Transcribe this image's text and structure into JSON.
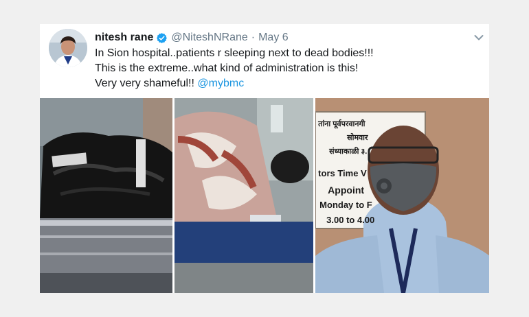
{
  "tweet": {
    "author_name": "nitesh rane",
    "handle": "@NiteshNRane",
    "separator": "·",
    "date": "May 6",
    "lines": [
      "In Sion hospital..patients r sleeping next to dead bodies!!!",
      "This is the extreme..what kind of administration is this!",
      "Very very shameful!! "
    ],
    "mention": "@mybmc"
  },
  "media": {
    "sign_lines": [
      "तांना पूर्वपरवानगी",
      "सोमवार",
      "संध्याकाळी ३.",
      "tors Time V",
      "Appoint",
      "Monday to F",
      "3.00 to 4.00"
    ]
  },
  "colors": {
    "verified": "#1da1f2",
    "mention": "#1b95e0",
    "secondary_text": "#657786"
  },
  "icons": [
    "verified-badge-icon",
    "chevron-down-icon"
  ]
}
